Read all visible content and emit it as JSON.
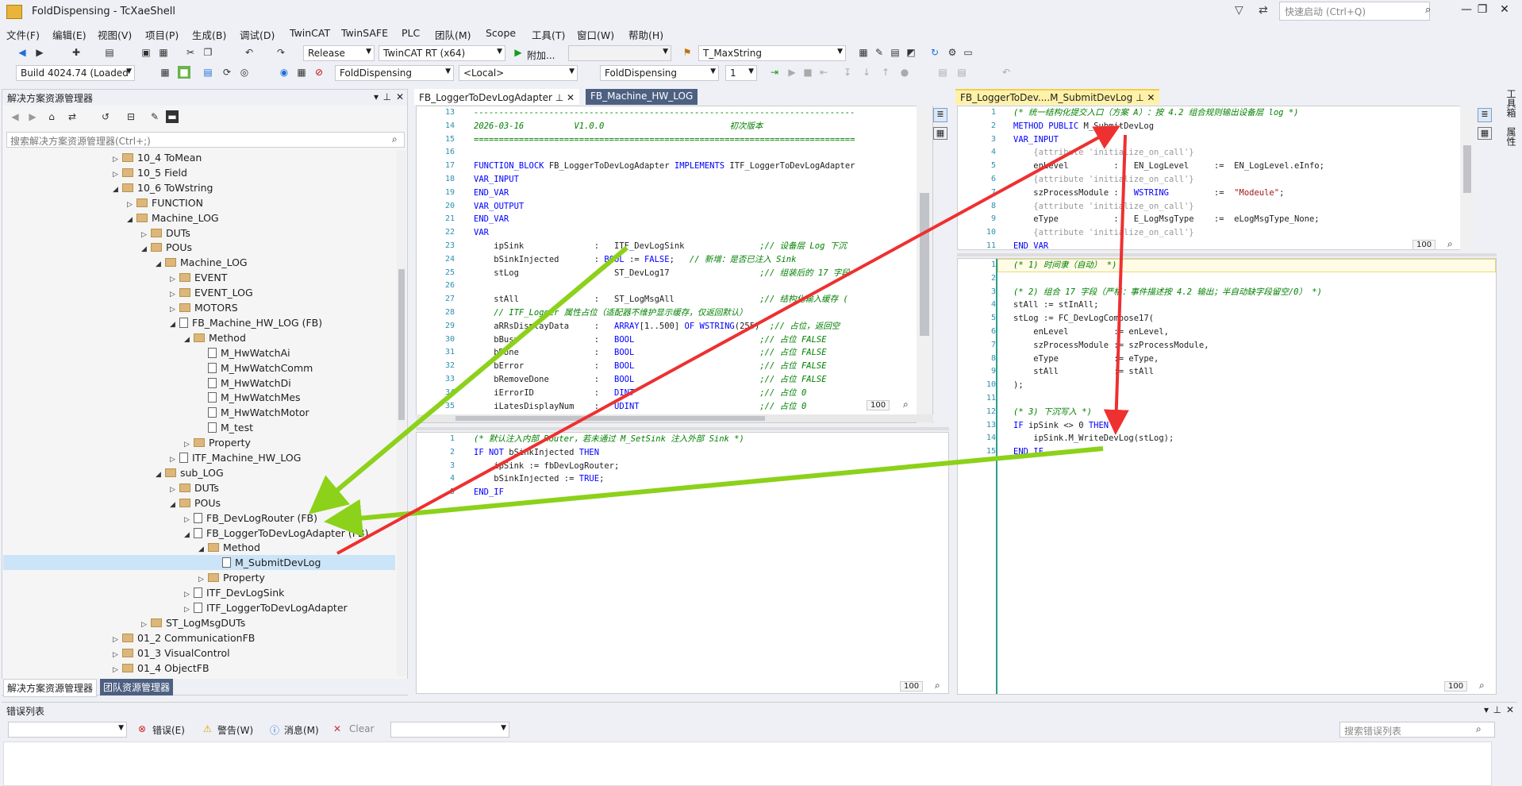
{
  "app": {
    "title": "FoldDispensing - TcXaeShell",
    "quick_launch": "快速启动 (Ctrl+Q)"
  },
  "menu": [
    "文件(F)",
    "编辑(E)",
    "视图(V)",
    "项目(P)",
    "生成(B)",
    "调试(D)",
    "TwinCAT",
    "TwinSAFE",
    "PLC",
    "团队(M)",
    "Scope",
    "工具(T)",
    "窗口(W)",
    "帮助(H)"
  ],
  "toolbar1": {
    "config": "Release",
    "platform": "TwinCAT RT (x64)",
    "attach": "附加...",
    "target": "",
    "search_combo": "T_MaxString"
  },
  "toolbar2": {
    "build": "Build 4024.74 (Loaded",
    "project": "FoldDispensing",
    "local": "<Local>",
    "plc": "FoldDispensing",
    "task": "1"
  },
  "solution_explorer": {
    "title": "解决方案资源管理器",
    "search_placeholder": "搜索解决方案资源管理器(Ctrl+;)",
    "items": [
      {
        "label": "10_4 ToMean",
        "depth": 4,
        "type": "folder",
        "exp": "closed"
      },
      {
        "label": "10_5 Field",
        "depth": 4,
        "type": "folder",
        "exp": "closed"
      },
      {
        "label": "10_6 ToWstring",
        "depth": 4,
        "type": "folder",
        "exp": "open"
      },
      {
        "label": "FUNCTION",
        "depth": 5,
        "type": "folder",
        "exp": "closed"
      },
      {
        "label": "Machine_LOG",
        "depth": 5,
        "type": "folder",
        "exp": "open"
      },
      {
        "label": "DUTs",
        "depth": 6,
        "type": "folder",
        "exp": "closed"
      },
      {
        "label": "POUs",
        "depth": 6,
        "type": "folder",
        "exp": "open"
      },
      {
        "label": "Machine_LOG",
        "depth": 7,
        "type": "folder",
        "exp": "open"
      },
      {
        "label": "EVENT",
        "depth": 8,
        "type": "folder",
        "exp": "closed"
      },
      {
        "label": "EVENT_LOG",
        "depth": 8,
        "type": "folder",
        "exp": "closed"
      },
      {
        "label": "MOTORS",
        "depth": 8,
        "type": "folder",
        "exp": "closed"
      },
      {
        "label": "FB_Machine_HW_LOG (FB)",
        "depth": 8,
        "type": "file",
        "exp": "open"
      },
      {
        "label": "Method",
        "depth": 9,
        "type": "folder",
        "exp": "open"
      },
      {
        "label": "M_HwWatchAi",
        "depth": 10,
        "type": "file",
        "exp": "none"
      },
      {
        "label": "M_HwWatchComm",
        "depth": 10,
        "type": "file",
        "exp": "none"
      },
      {
        "label": "M_HwWatchDi",
        "depth": 10,
        "type": "file",
        "exp": "none"
      },
      {
        "label": "M_HwWatchMes",
        "depth": 10,
        "type": "file",
        "exp": "none"
      },
      {
        "label": "M_HwWatchMotor",
        "depth": 10,
        "type": "file",
        "exp": "none"
      },
      {
        "label": "M_test",
        "depth": 10,
        "type": "file",
        "exp": "none"
      },
      {
        "label": "Property",
        "depth": 9,
        "type": "folder",
        "exp": "closed"
      },
      {
        "label": "ITF_Machine_HW_LOG",
        "depth": 8,
        "type": "itf",
        "exp": "closed"
      },
      {
        "label": "sub_LOG",
        "depth": 7,
        "type": "folder",
        "exp": "open"
      },
      {
        "label": "DUTs",
        "depth": 8,
        "type": "folder",
        "exp": "closed"
      },
      {
        "label": "POUs",
        "depth": 8,
        "type": "folder",
        "exp": "open"
      },
      {
        "label": "FB_DevLogRouter (FB)",
        "depth": 9,
        "type": "file",
        "exp": "closed"
      },
      {
        "label": "FB_LoggerToDevLogAdapter (FB)",
        "depth": 9,
        "type": "file",
        "exp": "open"
      },
      {
        "label": "Method",
        "depth": 10,
        "type": "folder",
        "exp": "open"
      },
      {
        "label": "M_SubmitDevLog",
        "depth": 11,
        "type": "file",
        "exp": "none",
        "selected": true
      },
      {
        "label": "Property",
        "depth": 10,
        "type": "folder",
        "exp": "closed"
      },
      {
        "label": "ITF_DevLogSink",
        "depth": 9,
        "type": "itf",
        "exp": "closed"
      },
      {
        "label": "ITF_LoggerToDevLogAdapter",
        "depth": 9,
        "type": "itf",
        "exp": "closed"
      },
      {
        "label": "ST_LogMsgDUTs",
        "depth": 6,
        "type": "folder",
        "exp": "closed"
      },
      {
        "label": "01_2 CommunicationFB",
        "depth": 4,
        "type": "folder",
        "exp": "closed"
      },
      {
        "label": "01_3 VisualControl",
        "depth": 4,
        "type": "folder",
        "exp": "closed"
      },
      {
        "label": "01_4 ObjectFB",
        "depth": 4,
        "type": "folder",
        "exp": "closed"
      }
    ],
    "bottom_tabs": [
      "解决方案资源管理器",
      "团队资源管理器"
    ]
  },
  "mid_editor": {
    "tabs": [
      "FB_LoggerToDevLogAdapter",
      "FB_Machine_HW_LOG"
    ],
    "zoom": "100",
    "decl_start": 13,
    "decl_lines": [
      "<span class='cm'>----------------------------------------------------------------------------</span>",
      "<span class='cm'>2026-03-16          V1.0.0                         初次版本</span>",
      "<span class='cm'>============================================================================</span>",
      "",
      "<span class='kw'>FUNCTION_BLOCK</span> FB_LoggerToDevLogAdapter <span class='kw'>IMPLEMENTS</span> ITF_LoggerToDevLogAdapter",
      "<span class='kw'>VAR_INPUT</span>",
      "<span class='kw'>END_VAR</span>",
      "<span class='kw'>VAR_OUTPUT</span>",
      "<span class='kw'>END_VAR</span>",
      "<span class='kw'>VAR</span>",
      "    ipSink              :   ITF_DevLogSink               <span class='cm'>;// 设备层 Log 下沉</span>",
      "    bSinkInjected       : <span class='kw'>BOOL</span> := <span class='kw'>FALSE</span>;   <span class='cm'>// 新增：是否已注入 Sink</span>",
      "    stLog               :   ST_DevLog17                  <span class='cm'>;// 组装后的 17 字段</span>",
      "",
      "    stAll               :   ST_LogMsgAll                 <span class='cm'>;// 结构化输入缓存 (</span>",
      "    <span class='cm'>// ITF_Logger 属性占位（适配器不维护显示缓存，仅返回默认）</span>",
      "    aRRsDisplayData     :   <span class='kw'>ARRAY</span>[1..500] <span class='kw'>OF WSTRING</span>(255)  <span class='cm'>;// 占位，返回空</span>",
      "    bBusy               :   <span class='kw'>BOOL</span>                         <span class='cm'>;// 占位 FALSE</span>",
      "    bDone               :   <span class='kw'>BOOL</span>                         <span class='cm'>;// 占位 FALSE</span>",
      "    bError              :   <span class='kw'>BOOL</span>                         <span class='cm'>;// 占位 FALSE</span>",
      "    bRemoveDone         :   <span class='kw'>BOOL</span>                         <span class='cm'>;// 占位 FALSE</span>",
      "    iErrorID            :   <span class='kw'>DINT</span>                         <span class='cm'>;// 占位 0</span>",
      "    iLatesDisplayNum    :   <span class='kw'>UDINT</span>                        <span class='cm'>;// 占位 0</span>"
    ],
    "impl_lines": [
      "<span class='cm'>(* 默认注入内部 Router，若未通过 M_SetSink 注入外部 Sink *)</span>",
      "<span class='kw'>IF NOT</span> bSinkInjected <span class='kw'>THEN</span>",
      "    ipSink := fbDevLogRouter;",
      "    bSinkInjected := <span class='kw'>TRUE</span>;",
      "<span class='kw'>END_IF</span>"
    ]
  },
  "right_editor": {
    "tab": "FB_LoggerToDev....M_SubmitDevLog",
    "zoom": "100",
    "decl_lines": [
      "<span class='cm'>(* 统一结构化提交入口（方案 A）：按 4.2 组合规则输出设备层 log *)</span>",
      "<span class='kw'>METHOD PUBLIC</span> M_SubmitDevLog",
      "<span class='kw'>VAR_INPUT</span>",
      "    <span class='cm' style='color:#999;font-style:normal'>{attribute 'initialize_on_call'}</span>",
      "    enLevel         :   EN_LogLevel     :=  EN_LogLevel.eInfo;",
      "    <span class='cm' style='color:#999;font-style:normal'>{attribute 'initialize_on_call'}</span>",
      "    szProcessModule :   <span class='kw'>WSTRING</span>         :=  <span class='st'>\"Modeule\"</span>;",
      "    <span class='cm' style='color:#999;font-style:normal'>{attribute 'initialize_on_call'}</span>",
      "    eType           :   E_LogMsgType    :=  eLogMsgType_None;",
      "    <span class='cm' style='color:#999;font-style:normal'>{attribute 'initialize_on_call'}</span>",
      "<span class='kw'>END_VAR</span>"
    ],
    "impl_lines": [
      "<span class='cm'>(* 1) 时间隶（自动） *)</span>",
      "",
      "<span class='cm'>(* 2) 组合 17 字段（严格：事件描述按 4.2 输出；半自动缺字段留空/0） *)</span>",
      "stAll := stInAll;",
      "stLog := FC_DevLogCompose17(",
      "    enLevel         := enLevel,",
      "    szProcessModule := szProcessModule,",
      "    eType           := eType,",
      "    stAll           := stAll",
      ");",
      "",
      "<span class='cm'>(* 3) 下沉写入 *)</span>",
      "<span class='kw'>IF</span> ipSink &lt;&gt; 0 <span class='kw'>THEN</span>",
      "    ipSink.M_WriteDevLog(stLog);",
      "<span class='kw'>END_IF</span>"
    ]
  },
  "side_tabs": [
    "工具箱",
    "属性"
  ],
  "error_list": {
    "title": "错误列表",
    "errors": "错误(E)",
    "warnings": "警告(W)",
    "messages": "消息(M)",
    "clear": "Clear",
    "search_placeholder": "搜索错误列表"
  },
  "colors": {
    "arrow_green": "#8cd11a",
    "arrow_red": "#ee3030",
    "accent": "#007acc"
  }
}
